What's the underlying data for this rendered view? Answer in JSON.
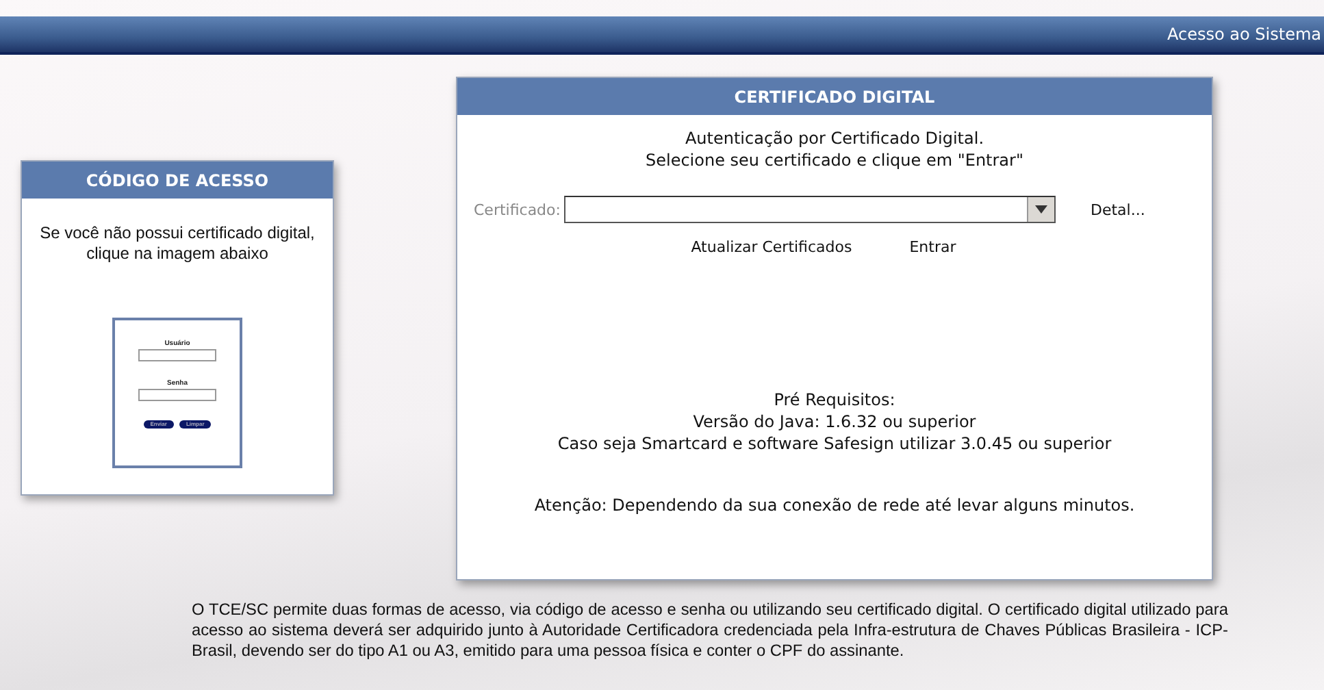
{
  "header": {
    "title": "Acesso ao Sistema"
  },
  "access_code_card": {
    "title": "CÓDIGO DE ACESSO",
    "text": "Se você não possui certificado digital, clique na imagem abaixo",
    "login_image": {
      "user_label": "Usuário",
      "password_label": "Senha",
      "buttons": [
        "Enviar",
        "Limpar"
      ]
    }
  },
  "certificate_card": {
    "title": "CERTIFICADO DIGITAL",
    "intro": [
      "Autenticação por Certificado Digital.",
      "Selecione seu certificado e clique em \"Entrar\""
    ],
    "field_label": "Certificado:",
    "details_link": "Detal...",
    "actions": [
      "Atualizar Certificados",
      "Entrar"
    ],
    "requirements": [
      "Pré Requisitos:",
      "Versão do Java: 1.6.32 ou superior",
      "Caso seja Smartcard e software Safesign utilizar 3.0.45 ou superior"
    ],
    "notice": "Atenção: Dependendo da sua conexão de rede até levar alguns minutos."
  },
  "footer_text": "O TCE/SC permite duas formas de acesso, via código de acesso e senha ou utilizando seu certificado digital. O certificado digital utilizado para acesso ao sistema deverá ser adquirido junto à Autoridade Certificadora credenciada pela Infra-estrutura de Chaves Públicas Brasileira - ICP-Brasil, devendo ser do tipo A1 ou A3, emitido para uma pessoa física e conter o CPF do assinante."
}
